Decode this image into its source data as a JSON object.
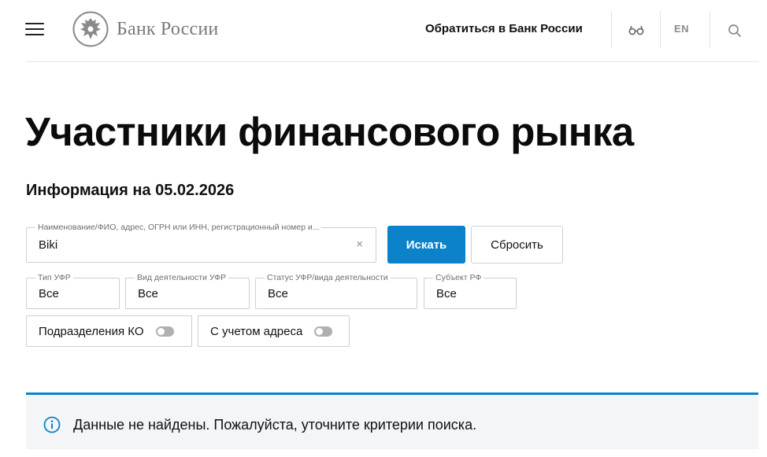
{
  "header": {
    "logo_text": "Банк России",
    "contact_link": "Обратиться в Банк России",
    "lang": "EN"
  },
  "main": {
    "title": "Участники финансового рынка",
    "info_date": "Информация на 05.02.2026"
  },
  "search": {
    "legend": "Наименование/ФИО, адрес, ОГРН или ИНН, регистрационный номер и...",
    "value": "Biki",
    "clear": "×",
    "submit_label": "Искать",
    "reset_label": "Сбросить"
  },
  "filters": [
    {
      "legend": "Тип УФР",
      "value": "Все"
    },
    {
      "legend": "Вид деятельности УФР",
      "value": "Все"
    },
    {
      "legend": "Статус УФР/вида деятельности",
      "value": "Все"
    },
    {
      "legend": "Субъект РФ",
      "value": "Все"
    }
  ],
  "toggles": [
    {
      "label": "Подразделения КО",
      "state": "off"
    },
    {
      "label": "С учетом адреса",
      "state": "off"
    }
  ],
  "notice": {
    "text": "Данные не найдены. Пожалуйста, уточните критерии поиска."
  },
  "colors": {
    "accent": "#0b82c9",
    "notice_bg": "#f3f5f6"
  },
  "icons": [
    "menu-icon",
    "bank-emblem-icon",
    "glasses-icon",
    "search-icon",
    "info-icon"
  ]
}
